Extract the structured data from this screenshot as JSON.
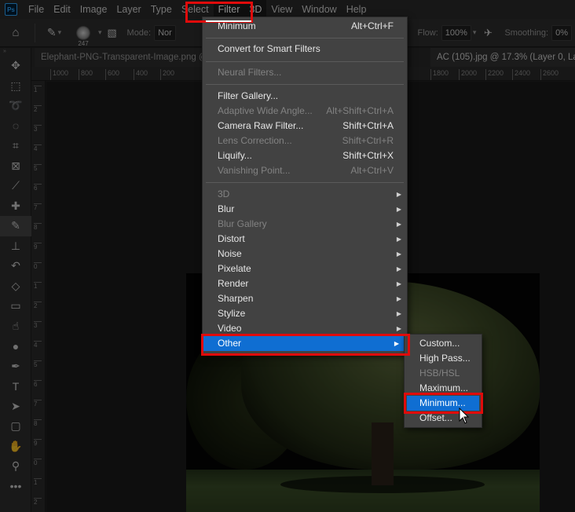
{
  "app": {
    "logo": "Ps"
  },
  "menubar": {
    "items": [
      "File",
      "Edit",
      "Image",
      "Layer",
      "Type",
      "Select",
      "Filter",
      "3D",
      "View",
      "Window",
      "Help"
    ],
    "active": "Filter"
  },
  "options": {
    "brush_size": "247",
    "mode_label": "Mode:",
    "mode_value": "Nor",
    "flow_label": "Flow:",
    "flow_value": "100%",
    "smoothing_label": "Smoothing:",
    "smoothing_value": "0%"
  },
  "tabs": [
    {
      "label": "Elephant-PNG-Transparent-Image.png @"
    },
    {
      "label": "AC (105).jpg @ 17.3% (Layer 0, Lay"
    }
  ],
  "ruler": {
    "h_labels": [
      "1000",
      "800",
      "600",
      "400",
      "200",
      "1800",
      "2000",
      "2200",
      "2400",
      "2600"
    ],
    "v_labels": [
      "1",
      "2",
      "3",
      "4",
      "5",
      "6",
      "7",
      "8",
      "9",
      "0",
      "1",
      "2",
      "3",
      "4",
      "5",
      "6",
      "7",
      "8",
      "9",
      "0",
      "1",
      "2"
    ]
  },
  "filter_menu": {
    "items": [
      {
        "label": "Minimum",
        "shortcut": "Alt+Ctrl+F",
        "disabled": false
      },
      {
        "label": "Convert for Smart Filters",
        "shortcut": "",
        "disabled": false
      },
      {
        "label": "Neural Filters...",
        "shortcut": "",
        "disabled": true
      },
      {
        "label": "Filter Gallery...",
        "shortcut": "",
        "disabled": false
      },
      {
        "label": "Adaptive Wide Angle...",
        "shortcut": "Alt+Shift+Ctrl+A",
        "disabled": true
      },
      {
        "label": "Camera Raw Filter...",
        "shortcut": "Shift+Ctrl+A",
        "disabled": false
      },
      {
        "label": "Lens Correction...",
        "shortcut": "Shift+Ctrl+R",
        "disabled": true
      },
      {
        "label": "Liquify...",
        "shortcut": "Shift+Ctrl+X",
        "disabled": false
      },
      {
        "label": "Vanishing Point...",
        "shortcut": "Alt+Ctrl+V",
        "disabled": true
      },
      {
        "label": "3D",
        "submenu": true,
        "disabled": true
      },
      {
        "label": "Blur",
        "submenu": true,
        "disabled": false
      },
      {
        "label": "Blur Gallery",
        "submenu": true,
        "disabled": true
      },
      {
        "label": "Distort",
        "submenu": true,
        "disabled": false
      },
      {
        "label": "Noise",
        "submenu": true,
        "disabled": false
      },
      {
        "label": "Pixelate",
        "submenu": true,
        "disabled": false
      },
      {
        "label": "Render",
        "submenu": true,
        "disabled": false
      },
      {
        "label": "Sharpen",
        "submenu": true,
        "disabled": false
      },
      {
        "label": "Stylize",
        "submenu": true,
        "disabled": false
      },
      {
        "label": "Video",
        "submenu": true,
        "disabled": false
      },
      {
        "label": "Other",
        "submenu": true,
        "disabled": false,
        "highlighted": true
      }
    ]
  },
  "other_submenu": {
    "items": [
      {
        "label": "Custom...",
        "disabled": false
      },
      {
        "label": "High Pass...",
        "disabled": false
      },
      {
        "label": "HSB/HSL",
        "disabled": true
      },
      {
        "label": "Maximum...",
        "disabled": false
      },
      {
        "label": "Minimum...",
        "disabled": false,
        "highlighted": true
      },
      {
        "label": "Offset...",
        "disabled": false
      }
    ]
  },
  "colors": {
    "highlight": "#0f6ed2",
    "annotation": "#e00b0b"
  }
}
